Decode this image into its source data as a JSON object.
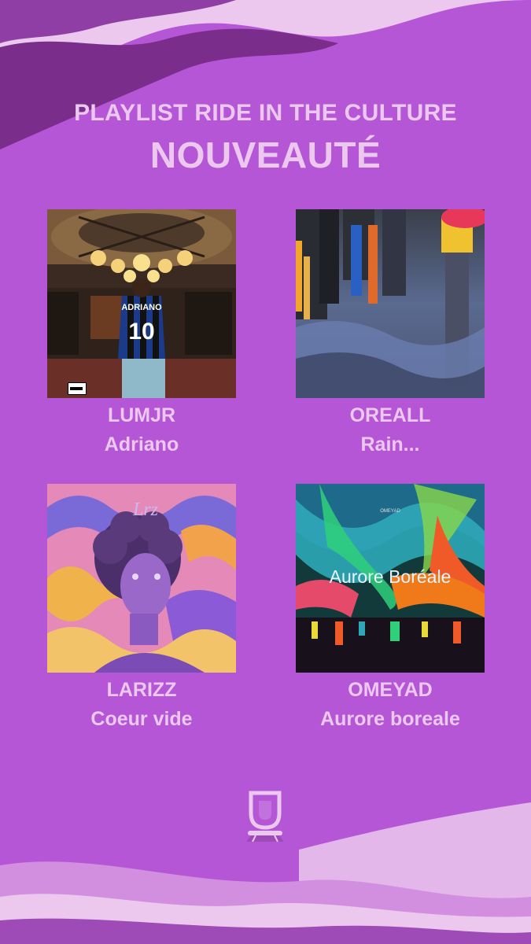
{
  "header": {
    "subtitle": "PLAYLIST RIDE IN THE CULTURE",
    "title": "NOUVEAUTÉ"
  },
  "releases": [
    {
      "artist": "LUMJR",
      "track": "Adriano",
      "cover_text": "ADRIANO",
      "jersey_number": "10"
    },
    {
      "artist": "OREALL",
      "track": "Rain..."
    },
    {
      "artist": "LARIZZ",
      "track": "Coeur vide",
      "cover_text": "Lrz"
    },
    {
      "artist": "OMEYAD",
      "track": "Aurore boreale",
      "cover_text": "Aurore Boréale",
      "cover_small_text": "OMEYAD"
    }
  ],
  "colors": {
    "background": "#b556d6",
    "text": "#ecc8ef",
    "wave_light": "#ecc8ef",
    "wave_dark": "#7a2d8a"
  },
  "icons": [
    "ride-logo-icon",
    "parental-advisory-icon"
  ]
}
